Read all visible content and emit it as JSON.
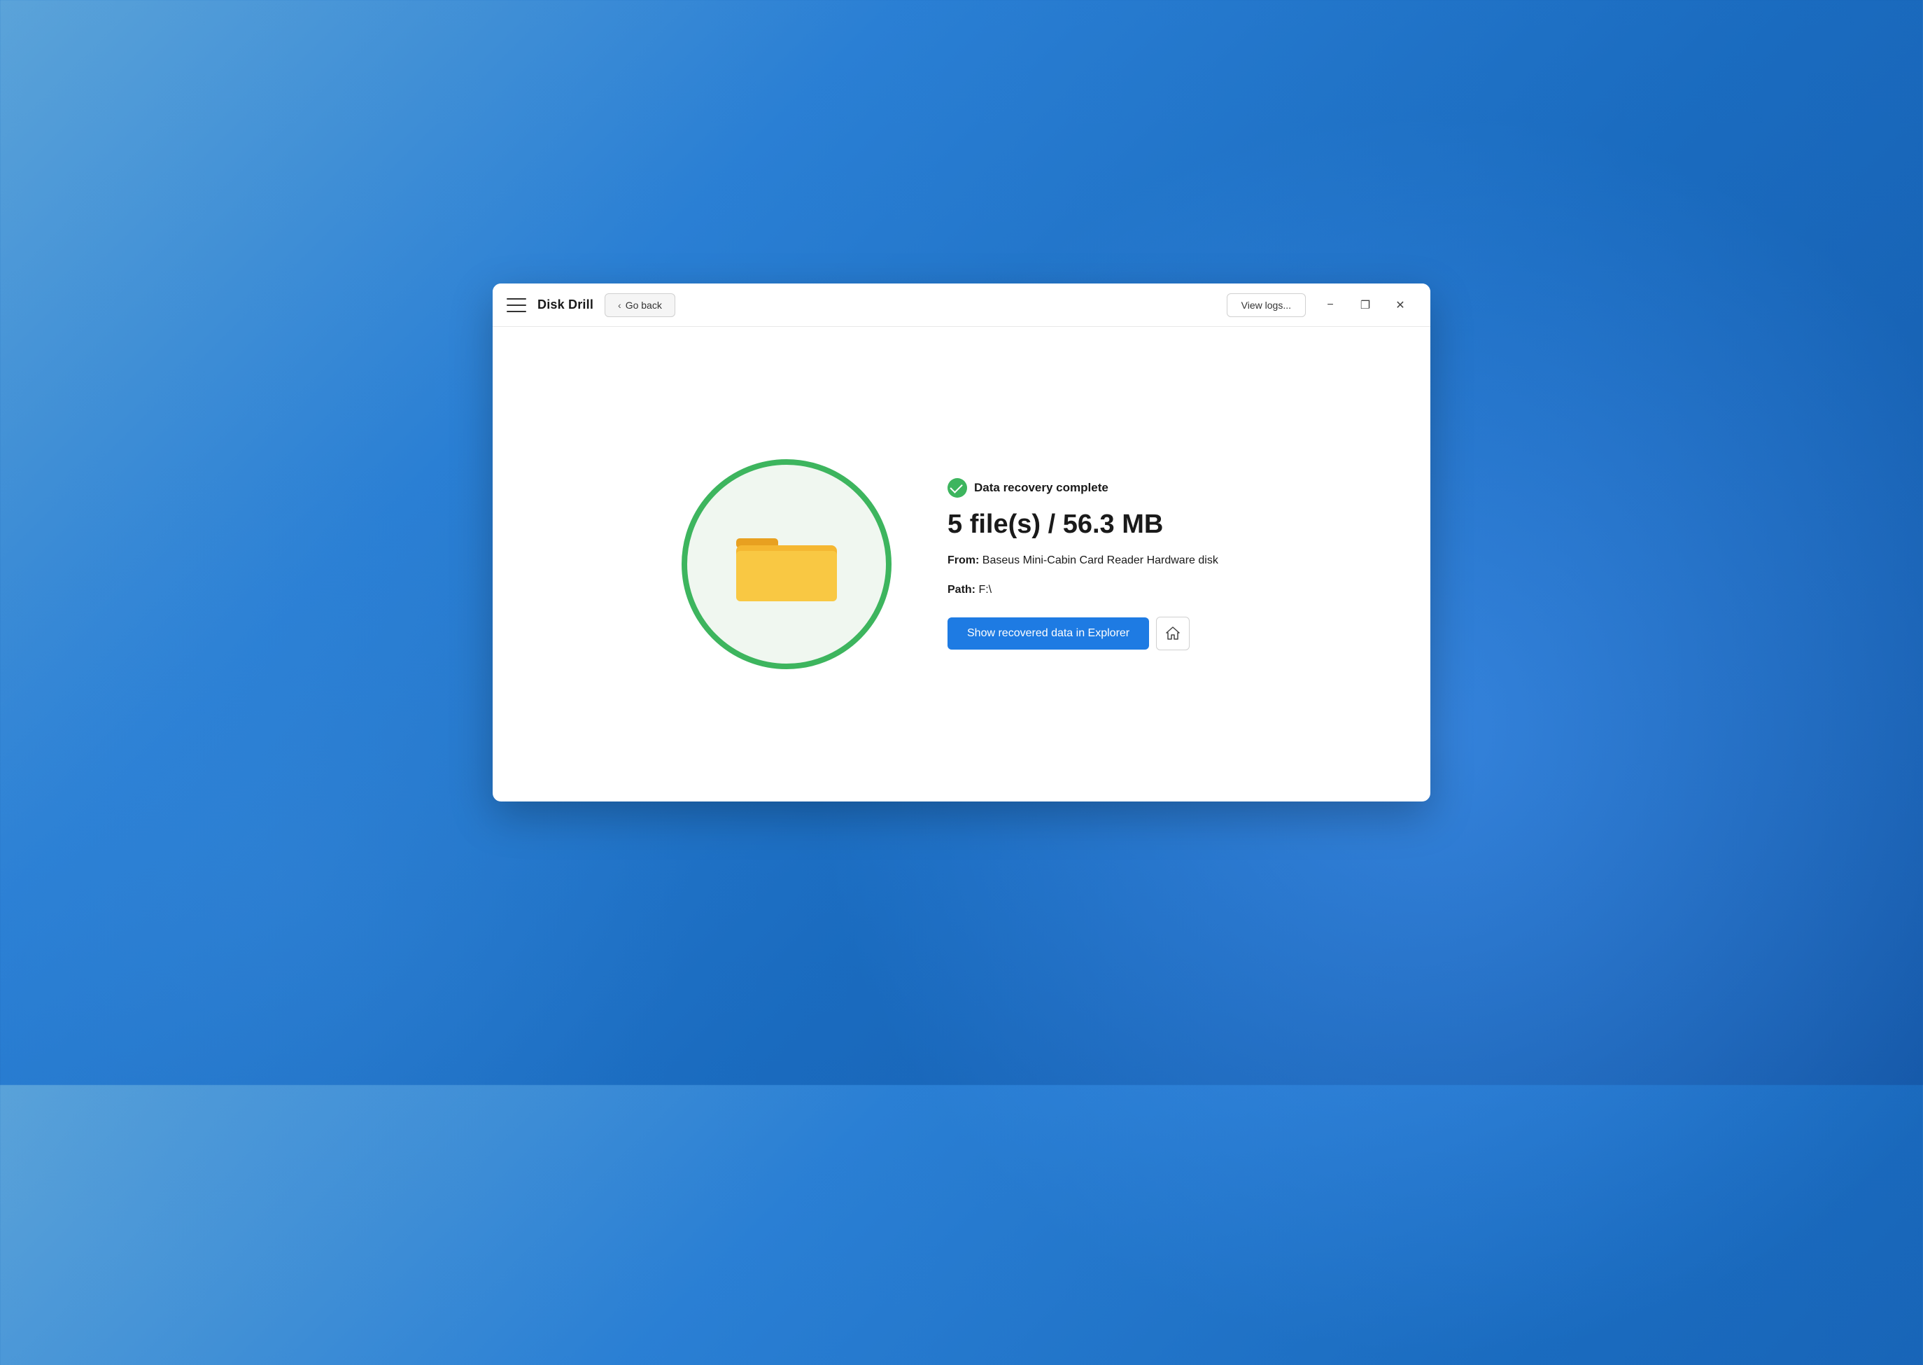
{
  "background": {
    "colors": [
      "#5ba3d9",
      "#2a7fd4",
      "#1a6bbf",
      "#1558a8"
    ]
  },
  "window": {
    "titlebar": {
      "menu_label": "menu",
      "app_title": "Disk Drill",
      "go_back_label": "Go back",
      "view_logs_label": "View logs...",
      "minimize_label": "−",
      "restore_label": "❐",
      "close_label": "✕"
    },
    "main": {
      "status_icon": "check-circle",
      "status_text": "Data recovery complete",
      "recovery_stats": "5 file(s) / 56.3 MB",
      "from_label": "From:",
      "device_name": "Baseus Mini-Cabin Card Reader",
      "device_type": "Hardware disk",
      "path_label": "Path:",
      "path_value": "F:\\",
      "show_explorer_btn_label": "Show recovered data in Explorer",
      "home_btn_label": "Home"
    }
  }
}
